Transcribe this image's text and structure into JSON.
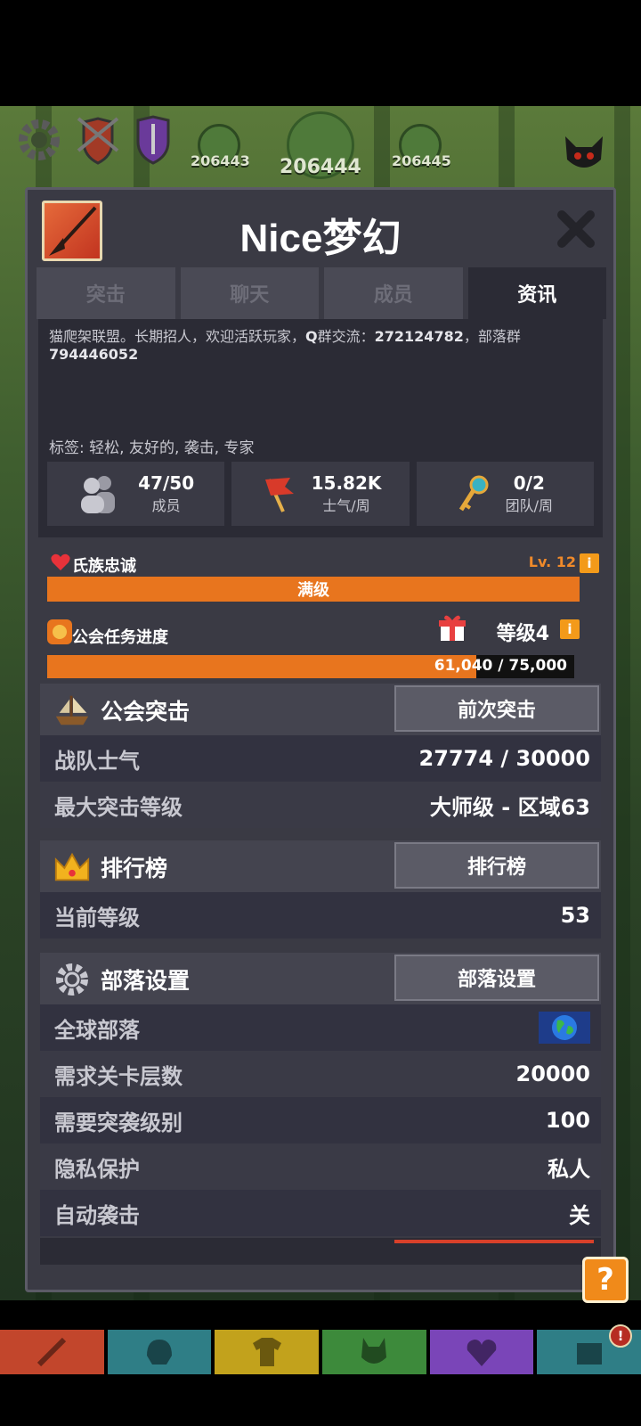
{
  "stages": {
    "left": "206443",
    "center": "206444",
    "right": "206445"
  },
  "panel": {
    "title": "Nice梦幻",
    "close": "✖"
  },
  "tabs": [
    {
      "label": "突击",
      "active": false
    },
    {
      "label": "聊天",
      "active": false
    },
    {
      "label": "成员",
      "active": false
    },
    {
      "label": "资讯",
      "active": true
    }
  ],
  "info": {
    "description_line1": "猫爬架联盟。长期招人，欢迎活跃玩家，",
    "description_q": "Q",
    "description_mid": "群交流：",
    "description_num1": "272124782",
    "description_tail": "，部落群",
    "description_num2": "794446052",
    "tags": "标签: 轻松, 友好的, 袭击, 专家",
    "stats": [
      {
        "value": "47/50",
        "label": "成员",
        "icon": "members-icon"
      },
      {
        "value": "15.82K",
        "label": "士气/周",
        "icon": "flag-icon"
      },
      {
        "value": "0/2",
        "label": "团队/周",
        "icon": "key-icon"
      }
    ]
  },
  "loyalty": {
    "label": "氏族忠诚",
    "level": "Lv. 12",
    "bar_text": "满级",
    "info": "i"
  },
  "task": {
    "label": "公会任务进度",
    "level": "等级4",
    "info": "i",
    "progress_text": "61,040 / 75,000",
    "progress": 0.8139
  },
  "raid": {
    "title": "公会突击",
    "button": "前次突击",
    "rows": [
      {
        "key": "战队士气",
        "value": "27774 / 30000"
      },
      {
        "key": "最大突击等级",
        "value": "大师级 - 区域63"
      }
    ]
  },
  "leaderboard": {
    "title": "排行榜",
    "button": "排行榜",
    "rows": [
      {
        "key": "当前等级",
        "value": "53"
      }
    ]
  },
  "settings": {
    "title": "部落设置",
    "button": "部落设置",
    "rows": [
      {
        "key": "全球部落",
        "value": ""
      },
      {
        "key": "需求关卡层数",
        "value": "20000"
      },
      {
        "key": "需要突袭级别",
        "value": "100"
      },
      {
        "key": "隐私保护",
        "value": "私人"
      },
      {
        "key": "自动袭击",
        "value": "关"
      }
    ]
  },
  "help": "?",
  "bottom_badge": "!",
  "colors": {
    "accent": "#e8751e",
    "panel": "#3a3a44",
    "bottom": [
      "#c2462c",
      "#2f7e86",
      "#c2a21c",
      "#3d8a3b",
      "#7a45b8",
      "#2f7e86"
    ]
  }
}
